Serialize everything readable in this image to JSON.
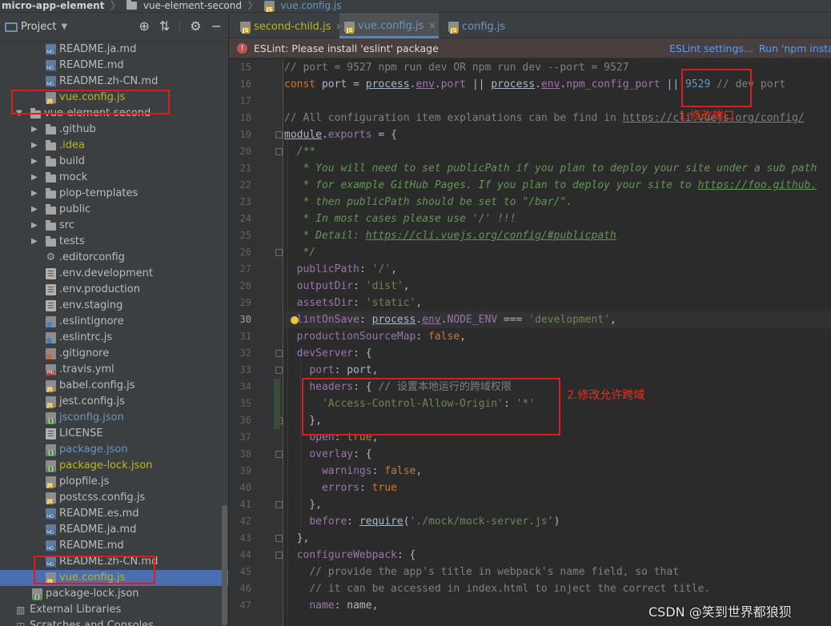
{
  "breadcrumb": {
    "project": "micro-app-element",
    "folder": "vue-element-second",
    "file": "vue.config.js"
  },
  "sidebar": {
    "title": "Project",
    "rows": [
      {
        "label": "README.ja.md",
        "icon": "md-file-icon",
        "color": "normal"
      },
      {
        "label": "README.md",
        "icon": "md-file-icon",
        "color": "normal"
      },
      {
        "label": "README.zh-CN.md",
        "icon": "md-file-icon",
        "color": "normal"
      },
      {
        "label": "vue.config.js",
        "icon": "js-file-icon",
        "color": "yellow"
      },
      {
        "label": "vue-element-second",
        "icon": "folder-icon",
        "color": "normal",
        "expanded": true
      },
      {
        "label": ".github",
        "icon": "folder-icon",
        "color": "normal"
      },
      {
        "label": ".idea",
        "icon": "folder-icon",
        "color": "yellow"
      },
      {
        "label": "build",
        "icon": "folder-icon",
        "color": "normal"
      },
      {
        "label": "mock",
        "icon": "folder-icon",
        "color": "normal"
      },
      {
        "label": "plop-templates",
        "icon": "folder-icon",
        "color": "normal"
      },
      {
        "label": "public",
        "icon": "folder-icon",
        "color": "normal"
      },
      {
        "label": "src",
        "icon": "folder-icon",
        "color": "normal"
      },
      {
        "label": "tests",
        "icon": "folder-icon",
        "color": "normal"
      },
      {
        "label": ".editorconfig",
        "icon": "gear-file-icon",
        "color": "normal"
      },
      {
        "label": ".env.development",
        "icon": "text-file-icon",
        "color": "normal"
      },
      {
        "label": ".env.production",
        "icon": "text-file-icon",
        "color": "normal"
      },
      {
        "label": ".env.staging",
        "icon": "text-file-icon",
        "color": "normal"
      },
      {
        "label": ".eslintignore",
        "icon": "eslint-file-icon",
        "color": "normal"
      },
      {
        "label": ".eslintrc.js",
        "icon": "eslint-file-icon",
        "color": "normal"
      },
      {
        "label": ".gitignore",
        "icon": "git-file-icon",
        "color": "normal"
      },
      {
        "label": ".travis.yml",
        "icon": "yml-file-icon",
        "color": "normal"
      },
      {
        "label": "babel.config.js",
        "icon": "js-file-icon",
        "color": "normal"
      },
      {
        "label": "jest.config.js",
        "icon": "js-file-icon",
        "color": "normal"
      },
      {
        "label": "jsconfig.json",
        "icon": "json-file-icon",
        "color": "blue"
      },
      {
        "label": "LICENSE",
        "icon": "text-file-icon",
        "color": "normal"
      },
      {
        "label": "package.json",
        "icon": "json-file-icon",
        "color": "blue"
      },
      {
        "label": "package-lock.json",
        "icon": "json-file-icon",
        "color": "yellow"
      },
      {
        "label": "plopfile.js",
        "icon": "js-file-icon",
        "color": "normal"
      },
      {
        "label": "postcss.config.js",
        "icon": "js-file-icon",
        "color": "normal"
      },
      {
        "label": "README.es.md",
        "icon": "md-file-icon",
        "color": "normal"
      },
      {
        "label": "README.ja.md",
        "icon": "md-file-icon",
        "color": "normal"
      },
      {
        "label": "README.md",
        "icon": "md-file-icon",
        "color": "normal"
      },
      {
        "label": "README.zh-CN.md",
        "icon": "md-file-icon",
        "color": "normal"
      },
      {
        "label": "vue.config.js",
        "icon": "js-file-icon",
        "color": "yellow",
        "selected": true
      },
      {
        "label": "package-lock.json",
        "icon": "json-file-icon",
        "color": "normal"
      },
      {
        "label": "External Libraries",
        "icon": "library-icon",
        "color": "normal"
      },
      {
        "label": "Scratches and Consoles",
        "icon": "scratches-icon",
        "color": "normal"
      }
    ]
  },
  "tabs": [
    {
      "label": "second-child.js",
      "active": false
    },
    {
      "label": "vue.config.js",
      "active": true
    },
    {
      "label": "config.js",
      "active": false
    }
  ],
  "eslint_banner": {
    "message": "ESLint: Please install 'eslint' package",
    "settings_link": "ESLint settings...",
    "run_link": "Run 'npm instal"
  },
  "editor": {
    "current_line": 30,
    "line_numbers": [
      "15",
      "16",
      "17",
      "18",
      "19",
      "20",
      "21",
      "22",
      "23",
      "24",
      "25",
      "26",
      "27",
      "28",
      "29",
      "30",
      "31",
      "32",
      "33",
      "34",
      "35",
      "36",
      "37",
      "38",
      "39",
      "40",
      "41",
      "42",
      "43",
      "44",
      "45",
      "46",
      "47"
    ]
  },
  "annotations": {
    "port_note": "1.修改端口",
    "headers_note": "2.修改允许跨域"
  },
  "watermark": "CSDN @笑到世界都狼狈",
  "colors": {
    "annotation_red": "#e01b1b",
    "selection_blue": "#4b6eaf"
  }
}
